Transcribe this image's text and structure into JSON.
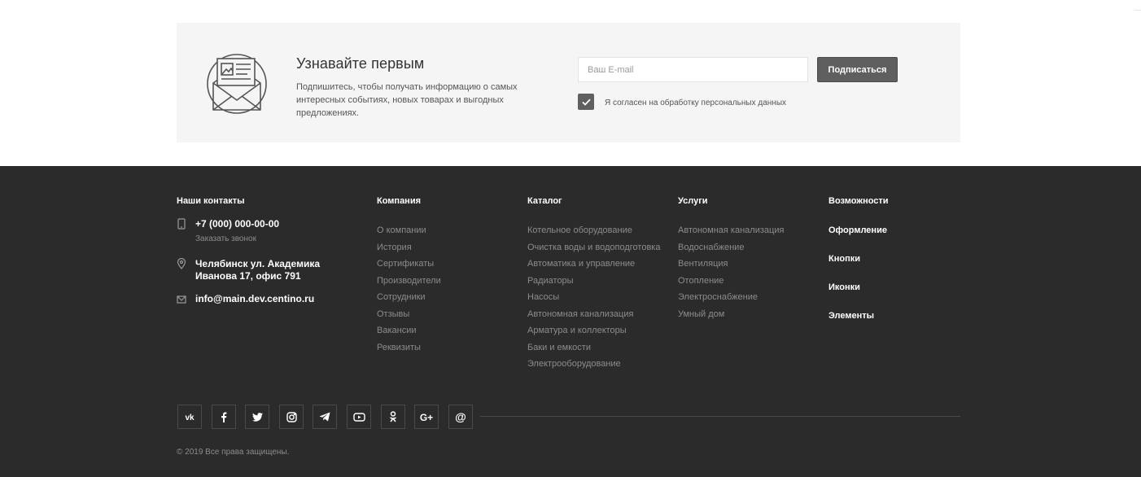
{
  "subscribe": {
    "title": "Узнавайте первым",
    "text": "Подпишитесь, чтобы получать информацию о самых интересных событиях, новых товарах и выгодных предложениях.",
    "email_placeholder": "Ваш E-mail",
    "button_label": "Подписаться",
    "consent_label": "Я согласен на обработку персональных данных",
    "consent_checked": true,
    "icon": "newsletter-envelope-icon"
  },
  "footer": {
    "contacts": {
      "title": "Наши контакты",
      "phone": "+7 (000) 000-00-00",
      "callback_label": "Заказать звонок",
      "address_line1": "Челябинск ул. Академика",
      "address_line2": "Иванова 17, офис 791",
      "email": "info@main.dev.centino.ru",
      "icons": [
        "phone-icon",
        "location-pin-icon",
        "mail-icon"
      ]
    },
    "company": {
      "title": "Компания",
      "links": [
        "О компании",
        "История",
        "Сертификаты",
        "Производители",
        "Сотрудники",
        "Отзывы",
        "Вакансии",
        "Реквизиты"
      ]
    },
    "catalog": {
      "title": "Каталог",
      "links": [
        "Котельное оборудование",
        "Очистка воды и водоподготовка",
        "Автоматика и управление",
        "Радиаторы",
        "Насосы",
        "Автономная канализация",
        "Арматура и коллекторы",
        "Баки и емкости",
        "Электрооборудование"
      ]
    },
    "services": {
      "title": "Услуги",
      "links": [
        "Автономная канализация",
        "Водоснабжение",
        "Вентиляция",
        "Отопление",
        "Электроснабжение",
        "Умный дом"
      ]
    },
    "features": {
      "title": "Возможности",
      "links": [
        "Оформление",
        "Кнопки",
        "Иконки",
        "Элементы"
      ]
    },
    "social": [
      {
        "name": "vk-icon",
        "glyph": "vk"
      },
      {
        "name": "facebook-icon",
        "glyph": "f"
      },
      {
        "name": "twitter-icon",
        "glyph": "tw"
      },
      {
        "name": "instagram-icon",
        "glyph": "ig"
      },
      {
        "name": "telegram-icon",
        "glyph": "tg"
      },
      {
        "name": "youtube-icon",
        "glyph": "yt"
      },
      {
        "name": "odnoklassniki-icon",
        "glyph": "ok"
      },
      {
        "name": "google-plus-icon",
        "glyph": "G+"
      },
      {
        "name": "mail-ru-icon",
        "glyph": "@"
      }
    ],
    "copyright": "© 2019 Все права защищены."
  },
  "colors": {
    "footer_bg": "#2b2b2b",
    "panel_bg": "#f5f5f5",
    "button_bg": "#5f5f5f",
    "link_muted": "#8c8c8c"
  }
}
